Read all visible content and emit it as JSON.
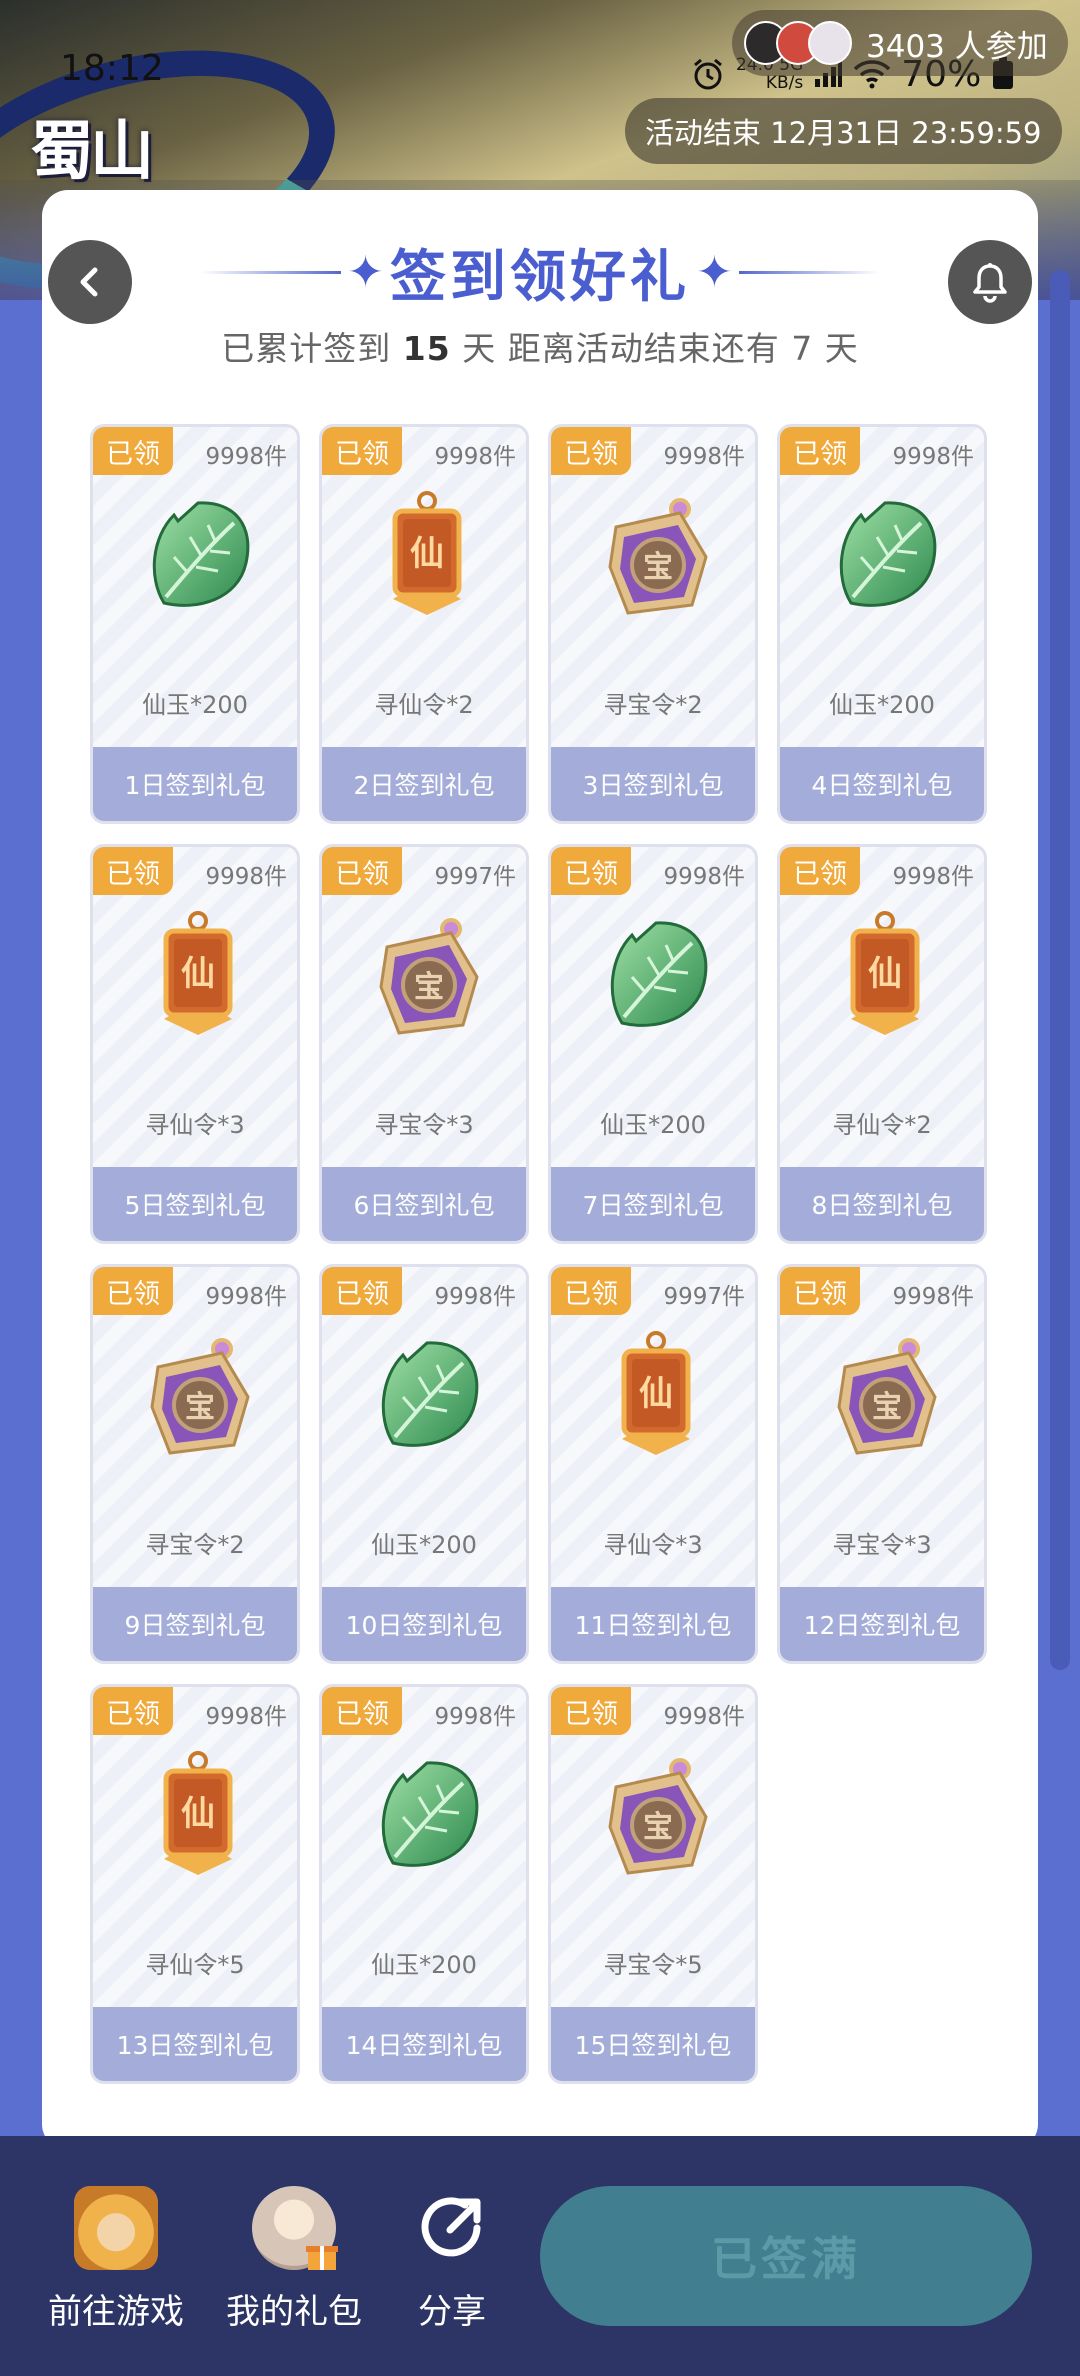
{
  "status_bar": {
    "time": "18:12",
    "net_speed": "24.0",
    "net_unit": "KB/s",
    "net_type": "5G",
    "battery": "70%"
  },
  "header": {
    "participants": "3403 人参加",
    "end_time": "活动结束 12月31日 23:59:59",
    "logo_text": "蜀山"
  },
  "title": "签到领好礼",
  "summary": {
    "prefix": "已累计签到",
    "days": "15",
    "middle": "天   距离活动结束还有 7 天"
  },
  "rewards": [
    {
      "badge": "已领",
      "stock": "9998件",
      "icon": "jade-leaf-icon",
      "qty": "仙玉*200",
      "label": "1日签到礼包"
    },
    {
      "badge": "已领",
      "stock": "9998件",
      "icon": "xian-token-icon",
      "qty": "寻仙令*2",
      "label": "2日签到礼包"
    },
    {
      "badge": "已领",
      "stock": "9998件",
      "icon": "treasure-token-icon",
      "qty": "寻宝令*2",
      "label": "3日签到礼包"
    },
    {
      "badge": "已领",
      "stock": "9998件",
      "icon": "jade-leaf-icon",
      "qty": "仙玉*200",
      "label": "4日签到礼包"
    },
    {
      "badge": "已领",
      "stock": "9998件",
      "icon": "xian-token-icon",
      "qty": "寻仙令*3",
      "label": "5日签到礼包"
    },
    {
      "badge": "已领",
      "stock": "9997件",
      "icon": "treasure-token-icon",
      "qty": "寻宝令*3",
      "label": "6日签到礼包"
    },
    {
      "badge": "已领",
      "stock": "9998件",
      "icon": "jade-leaf-icon",
      "qty": "仙玉*200",
      "label": "7日签到礼包"
    },
    {
      "badge": "已领",
      "stock": "9998件",
      "icon": "xian-token-icon",
      "qty": "寻仙令*2",
      "label": "8日签到礼包"
    },
    {
      "badge": "已领",
      "stock": "9998件",
      "icon": "treasure-token-icon",
      "qty": "寻宝令*2",
      "label": "9日签到礼包"
    },
    {
      "badge": "已领",
      "stock": "9998件",
      "icon": "jade-leaf-icon",
      "qty": "仙玉*200",
      "label": "10日签到礼包"
    },
    {
      "badge": "已领",
      "stock": "9997件",
      "icon": "xian-token-icon",
      "qty": "寻仙令*3",
      "label": "11日签到礼包"
    },
    {
      "badge": "已领",
      "stock": "9998件",
      "icon": "treasure-token-icon",
      "qty": "寻宝令*3",
      "label": "12日签到礼包"
    },
    {
      "badge": "已领",
      "stock": "9998件",
      "icon": "xian-token-icon",
      "qty": "寻仙令*5",
      "label": "13日签到礼包"
    },
    {
      "badge": "已领",
      "stock": "9998件",
      "icon": "jade-leaf-icon",
      "qty": "仙玉*200",
      "label": "14日签到礼包"
    },
    {
      "badge": "已领",
      "stock": "9998件",
      "icon": "treasure-token-icon",
      "qty": "寻宝令*5",
      "label": "15日签到礼包"
    }
  ],
  "bottom_nav": {
    "game": "前往游戏",
    "gifts": "我的礼包",
    "share": "分享",
    "main_button": "已签满"
  },
  "colors": {
    "accent": "#4a5ed0",
    "badge": "#f0a93b",
    "tile_footer": "#a4add9",
    "bottom_bar": "#2d3466",
    "main_button": "#417f90"
  }
}
